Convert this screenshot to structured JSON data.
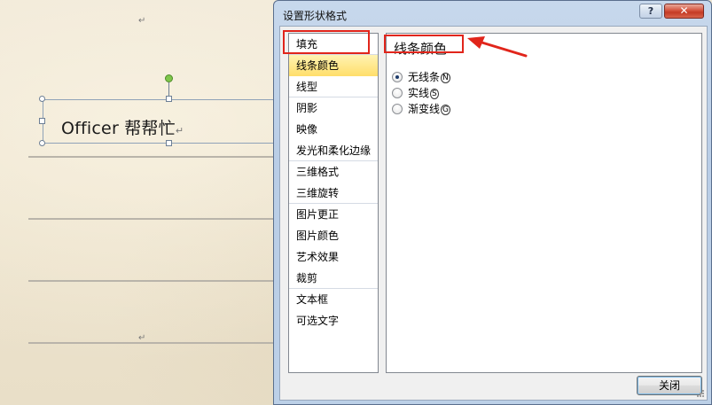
{
  "document": {
    "textbox_text": "Officer 帮帮忙",
    "paragraph_mark": "↵"
  },
  "dialog": {
    "title": "设置形状格式",
    "help_glyph": "?",
    "close_glyph": "✕",
    "categories": [
      {
        "label": "填充"
      },
      {
        "label": "线条颜色"
      },
      {
        "label": "线型"
      },
      {
        "label": "阴影"
      },
      {
        "label": "映像"
      },
      {
        "label": "发光和柔化边缘"
      },
      {
        "label": "三维格式"
      },
      {
        "label": "三维旋转"
      },
      {
        "label": "图片更正"
      },
      {
        "label": "图片颜色"
      },
      {
        "label": "艺术效果"
      },
      {
        "label": "裁剪"
      },
      {
        "label": "文本框"
      },
      {
        "label": "可选文字"
      }
    ],
    "selected_category": "线条颜色",
    "panel": {
      "title": "线条颜色",
      "options": [
        {
          "label": "无线条",
          "key": "N",
          "checked": true
        },
        {
          "label": "实线",
          "key": "S",
          "checked": false
        },
        {
          "label": "渐变线",
          "key": "G",
          "checked": false
        }
      ]
    },
    "close_button_label": "关闭"
  },
  "colors": {
    "highlight_box": "#e1251b",
    "selected_item": "#ffde6a",
    "dialog_frame": "#bcd0e7"
  }
}
